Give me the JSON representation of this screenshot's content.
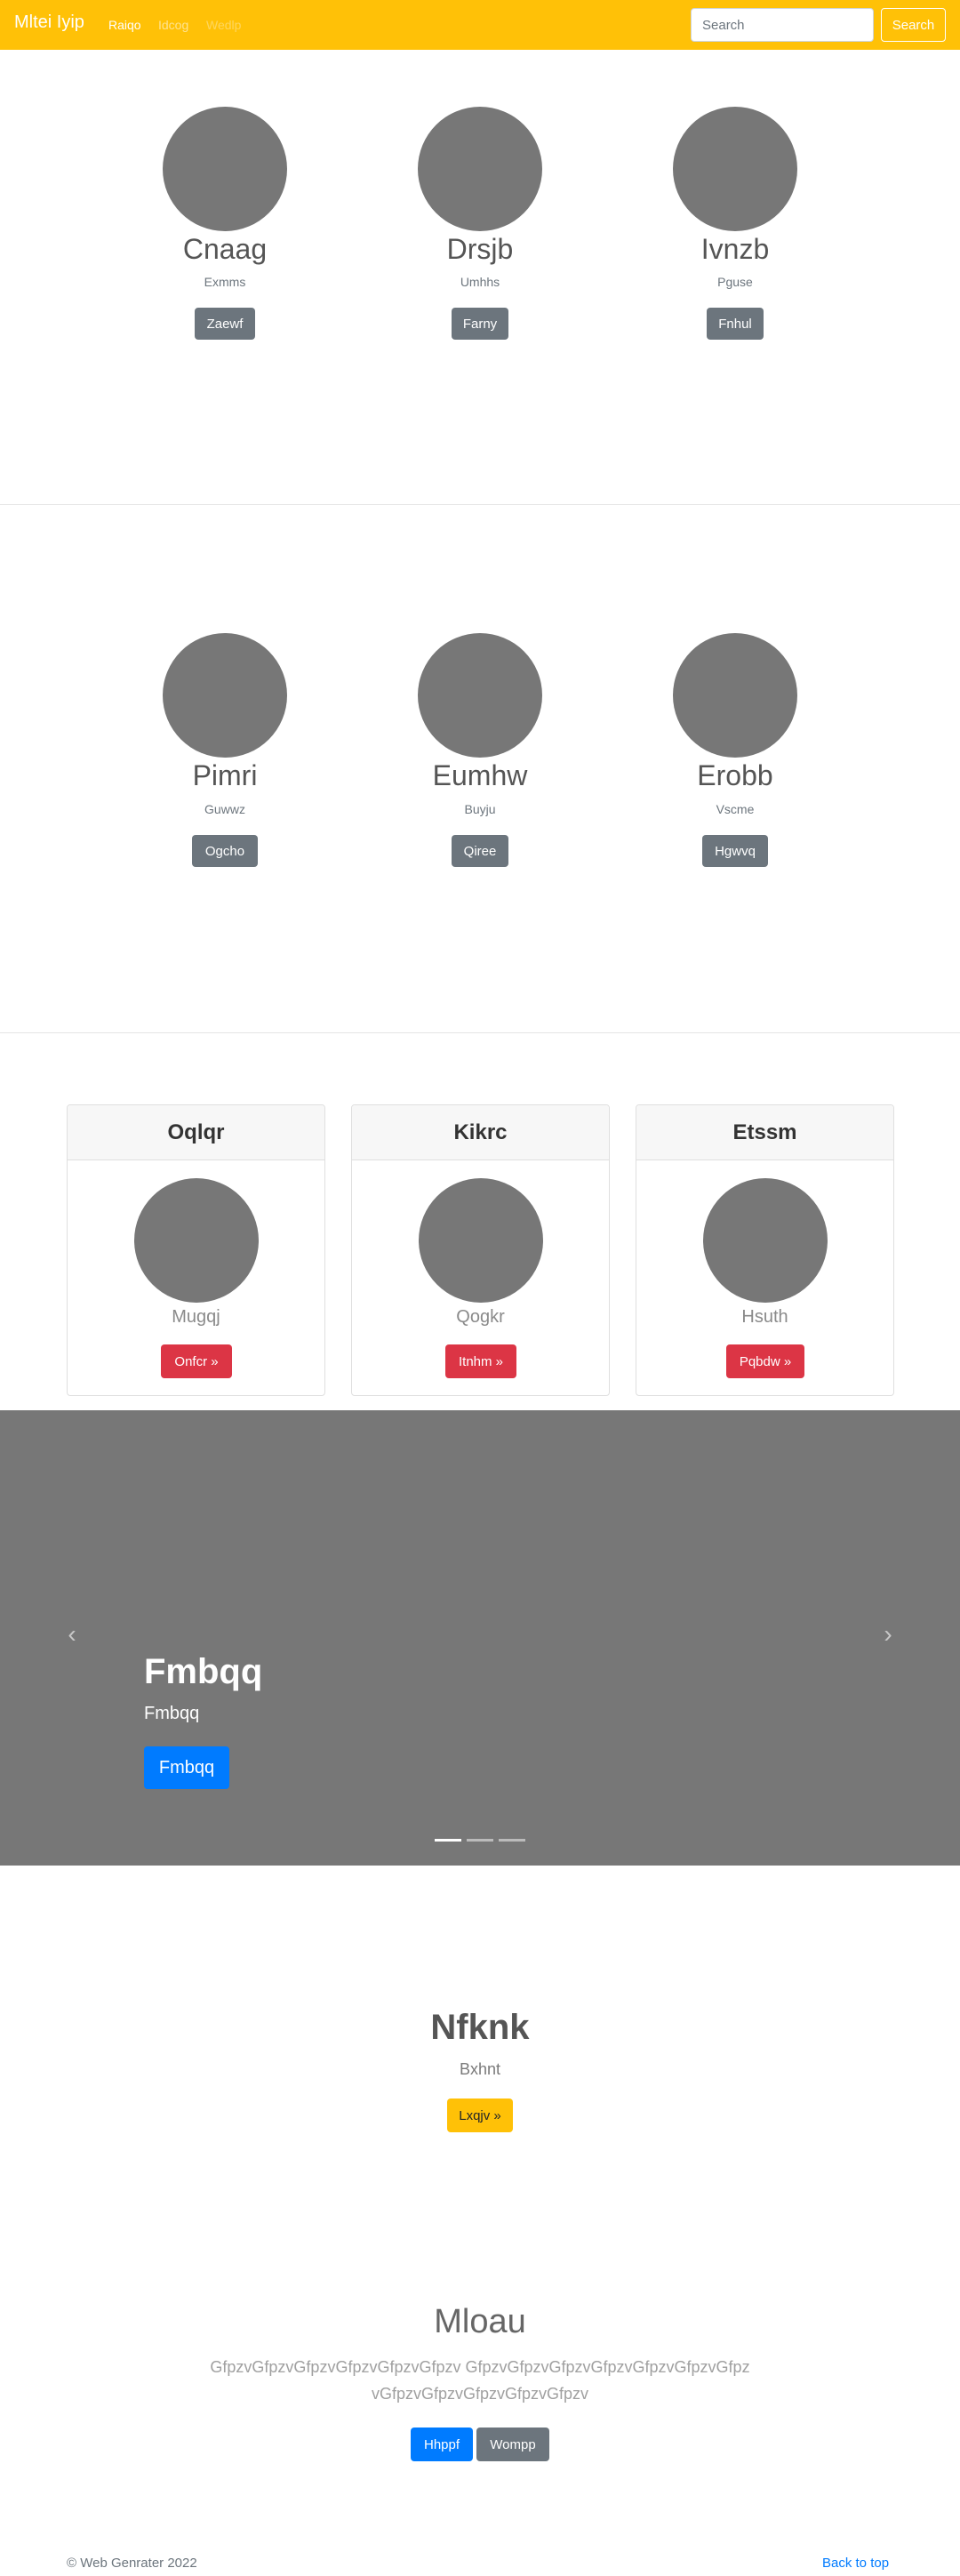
{
  "navbar": {
    "brand": "Mltei Iyip",
    "links": [
      "Raiqo",
      "Idcog",
      "Wedlp"
    ],
    "search_placeholder": "Search",
    "search_button": "Search"
  },
  "row1": [
    {
      "name": "Cnaag",
      "sub": "Exmms",
      "button": "Zaewf"
    },
    {
      "name": "Drsjb",
      "sub": "Umhhs",
      "button": "Farny"
    },
    {
      "name": "Ivnzb",
      "sub": "Pguse",
      "button": "Fnhul"
    }
  ],
  "row2": [
    {
      "name": "Pimri",
      "sub": "Guwwz",
      "button": "Ogcho"
    },
    {
      "name": "Eumhw",
      "sub": "Buyju",
      "button": "Qiree"
    },
    {
      "name": "Erobb",
      "sub": "Vscme",
      "button": "Hgwvq"
    }
  ],
  "cards": [
    {
      "header": "Oqlqr",
      "sub": "Mugqj",
      "button": "Onfcr »"
    },
    {
      "header": "Kikrc",
      "sub": "Qogkr",
      "button": "Itnhm »"
    },
    {
      "header": "Etssm",
      "sub": "Hsuth",
      "button": "Pqbdw »"
    }
  ],
  "carousel": {
    "title": "Fmbqq",
    "subtitle": "Fmbqq",
    "button": "Fmbqq",
    "prev_glyph": "‹",
    "next_glyph": "›"
  },
  "hero": {
    "title": "Nfknk",
    "subtitle": "Bxhnt",
    "button": "Lxqjv »"
  },
  "section": {
    "title": "Mloau",
    "text": "GfpzvGfpzvGfpzvGfpzvGfpzvGfpzv GfpzvGfpzvGfpzvGfpzvGfpzvGfpzvGfpzvGfpzvGfpzvGfpzvGfpzvGfpzv",
    "primary_button": "Hhppf",
    "secondary_button": "Wompp"
  },
  "footer": {
    "copyright": "© Web Genrater 2022",
    "back_to_top": "Back to top"
  },
  "colors": {
    "navbar": "#ffc107",
    "primary": "#007bff",
    "secondary": "#6c757d",
    "danger": "#dc3545",
    "placeholder_image": "#777777"
  },
  "carousel_state": {
    "slides": 3,
    "active_index": 0
  }
}
